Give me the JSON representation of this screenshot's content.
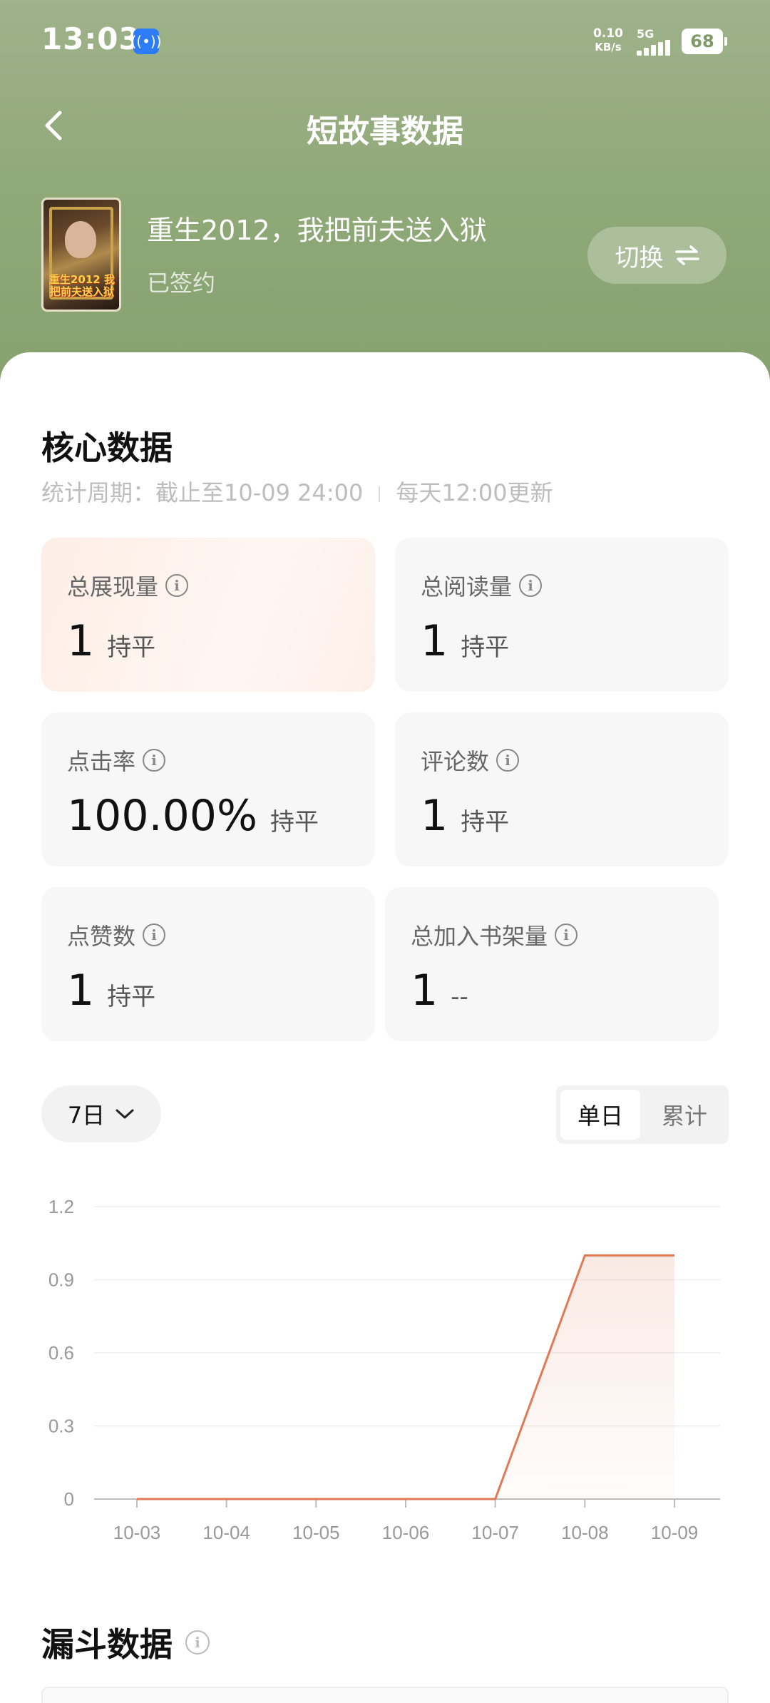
{
  "status_bar": {
    "time": "13:03",
    "net_speed": "0.10",
    "net_unit": "KB/s",
    "network": "5G",
    "battery": "68"
  },
  "header": {
    "title": "短故事数据"
  },
  "book": {
    "title": "重生2012，我把前夫送入狱",
    "status": "已签约",
    "cover_caption": "重生2012 我把前夫送入狱",
    "switch_label": "切换"
  },
  "core": {
    "title": "核心数据",
    "period": "统计周期：截止至10-09 24:00",
    "update": "每天12:00更新",
    "metrics": [
      {
        "label": "总展现量",
        "value": "1",
        "change": "持平"
      },
      {
        "label": "总阅读量",
        "value": "1",
        "change": "持平"
      },
      {
        "label": "点击率",
        "value": "100.00%",
        "change": "持平"
      },
      {
        "label": "评论数",
        "value": "1",
        "change": "持平"
      },
      {
        "label": "点赞数",
        "value": "1",
        "change": "持平"
      },
      {
        "label": "总加入书架量",
        "value": "1",
        "change": "--"
      }
    ]
  },
  "controls": {
    "range": "7日",
    "toggle": [
      "单日",
      "累计"
    ]
  },
  "chart_data": {
    "type": "area",
    "x": [
      "10-03",
      "10-04",
      "10-05",
      "10-06",
      "10-07",
      "10-08",
      "10-09"
    ],
    "values": [
      0,
      0,
      0,
      0,
      0,
      1,
      1
    ],
    "ylim": [
      0,
      1.2
    ],
    "yticks": [
      "0",
      "0.3",
      "0.6",
      "0.9",
      "1.2"
    ],
    "grid": true,
    "color": "#e07a55"
  },
  "funnel": {
    "title": "漏斗数据"
  }
}
